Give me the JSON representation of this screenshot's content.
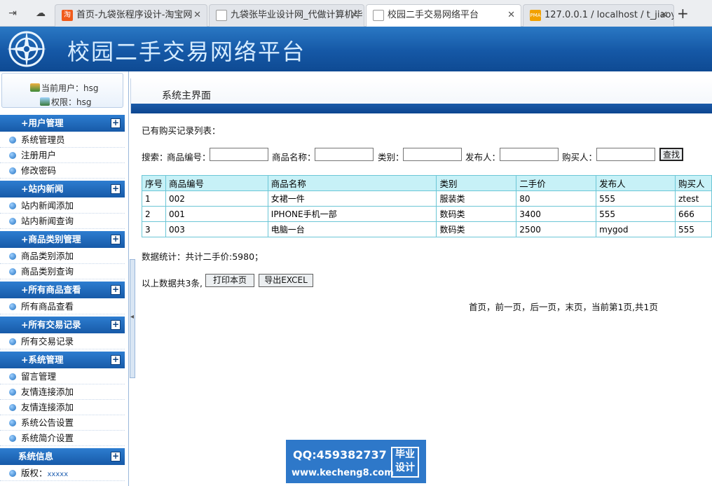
{
  "browser": {
    "tabs": [
      {
        "label": "首页-九袋张程序设计-淘宝网",
        "favicon": "淘"
      },
      {
        "label": "九袋张毕业设计网_代做计算机毕",
        "favicon": "doc"
      },
      {
        "label": "校园二手交易网络平台",
        "favicon": "doc"
      },
      {
        "label": "127.0.0.1 / localhost / t_jiaoy",
        "favicon": "PMA"
      }
    ]
  },
  "site": {
    "title": "校园二手交易网络平台"
  },
  "user": {
    "current": "当前用户：hsg",
    "role": "权限：hsg"
  },
  "sidebar": {
    "sections": [
      {
        "title": "+用户管理",
        "items": [
          "系统管理员",
          "注册用户",
          "修改密码"
        ]
      },
      {
        "title": "+站内新闻",
        "items": [
          "站内新闻添加",
          "站内新闻查询"
        ]
      },
      {
        "title": "+商品类别管理",
        "items": [
          "商品类别添加",
          "商品类别查询"
        ]
      },
      {
        "title": "+所有商品查看",
        "items": [
          "所有商品查看"
        ]
      },
      {
        "title": "+所有交易记录",
        "items": [
          "所有交易记录"
        ]
      },
      {
        "title": "+系统管理",
        "items": [
          "留言管理",
          "友情连接添加",
          "友情连接添加",
          "系统公告设置",
          "系统简介设置"
        ]
      },
      {
        "title": "系统信息",
        "items": [
          "版权："
        ]
      }
    ],
    "copyright_value": "xxxxx"
  },
  "main": {
    "header_title": "系统主界面",
    "list_title": "已有购买记录列表：",
    "search": {
      "prefix": "搜索：",
      "code_label": "商品编号：",
      "name_label": "商品名称：",
      "category_label": "类别：",
      "publisher_label": "发布人：",
      "buyer_label": "购买人：",
      "button": "查找"
    },
    "table": {
      "headers": [
        "序号",
        "商品编号",
        "商品名称",
        "类别",
        "二手价",
        "发布人",
        "购买人"
      ],
      "rows": [
        [
          "1",
          "002",
          "女裙一件",
          "服装类",
          "80",
          "555",
          "ztest"
        ],
        [
          "2",
          "001",
          "IPHONE手机一部",
          "数码类",
          "3400",
          "555",
          "666"
        ],
        [
          "3",
          "003",
          "电脑一台",
          "数码类",
          "2500",
          "mygod",
          "555"
        ]
      ]
    },
    "stats": "数据统计：共计二手价:5980；",
    "total_text": "以上数据共3条,",
    "print_button": "打印本页",
    "export_button": "导出EXCEL",
    "pagination": "首页，前一页，后一页，末页，当前第1页,共1页"
  },
  "promo": {
    "qq": "QQ:459382737",
    "url": "www.kecheng8.com",
    "badge_top": "毕业",
    "badge_bottom": "设计"
  }
}
